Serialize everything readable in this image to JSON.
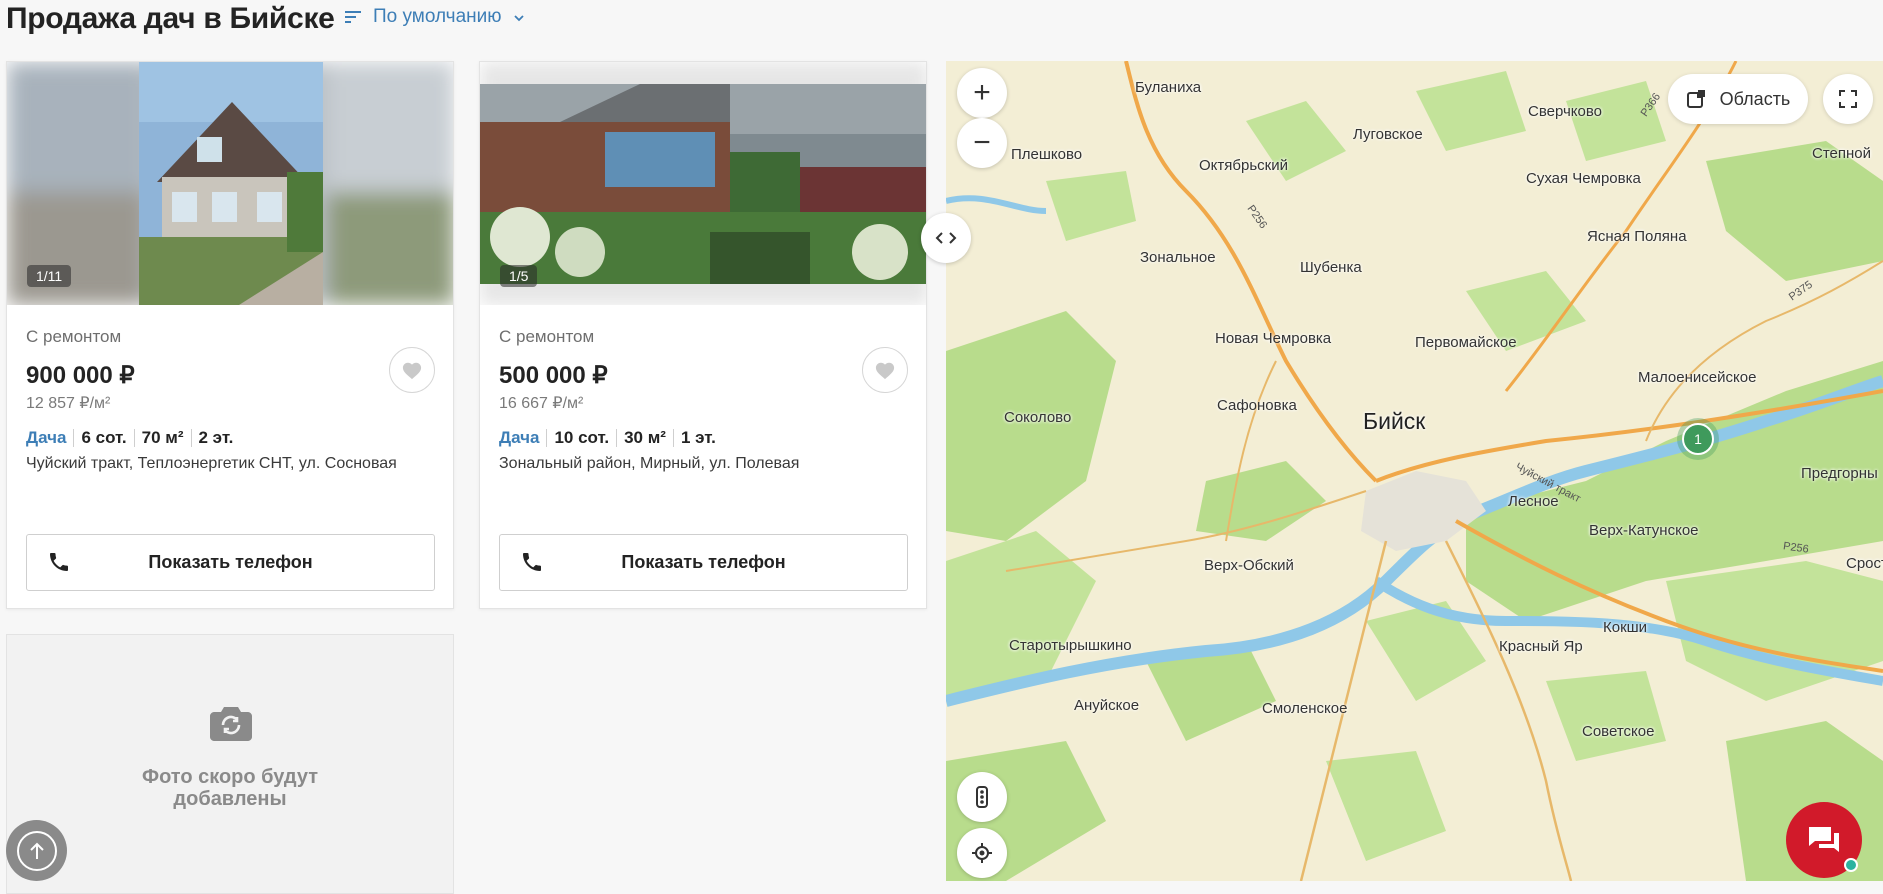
{
  "header": {
    "title": "Продажа дач в Бийске",
    "sort_label": "По умолчанию"
  },
  "listings": [
    {
      "photo_counter": "1/11",
      "condition": "С ремонтом",
      "price": "900 000 ₽",
      "price_per_m2": "12 857 ₽/м²",
      "type": "Дача",
      "land": "6 сот.",
      "area": "70 м²",
      "floors": "2 эт.",
      "address": "Чуйский тракт, Теплоэнергетик СНТ, ул. Сосновая",
      "phone_label": "Показать телефон"
    },
    {
      "photo_counter": "1/5",
      "condition": "С ремонтом",
      "price": "500 000 ₽",
      "price_per_m2": "16 667 ₽/м²",
      "type": "Дача",
      "land": "10 сот.",
      "area": "30 м²",
      "floors": "1 эт.",
      "address": "Зональный район, Мирный, ул. Полевая",
      "phone_label": "Показать телефон"
    }
  ],
  "placeholder_card": {
    "text_line1": "Фото скоро будут",
    "text_line2": "добавлены"
  },
  "map": {
    "area_button": "Область",
    "cluster_count": "1",
    "city": "Бийск",
    "places": [
      "Буланиха",
      "Луговское",
      "Сверчково",
      "Плешково",
      "Октябрьский",
      "Степной",
      "Сухая Чемровка",
      "Ясная Поляна",
      "Зональное",
      "Шубенка",
      "Новая Чемровка",
      "Первомайское",
      "Малоенисейское",
      "Соколово",
      "Сафоновка",
      "Предгорны",
      "Лесное",
      "Верх-Катунское",
      "Верх-Обский",
      "Сросты",
      "Кокши",
      "Старотырышкино",
      "Красный Яр",
      "Ануйское",
      "Смоленское",
      "Советское"
    ],
    "roads": [
      "Р256",
      "Р366",
      "Р375",
      "Чуйский тракт",
      "Р256"
    ]
  },
  "icons": {
    "sort": "sort-lines-icon",
    "fav": "heart-icon",
    "phone": "phone-icon",
    "camera": "camera-rotate-icon",
    "up": "arrow-up-icon",
    "area": "area-select-icon",
    "fullscreen": "fullscreen-icon",
    "traffic": "traffic-light-icon",
    "locate": "geolocation-icon",
    "chat": "chat-icon"
  },
  "colors": {
    "accent": "#3d7eb6",
    "chat": "#d11a2a",
    "cluster": "#3f9a5c"
  }
}
